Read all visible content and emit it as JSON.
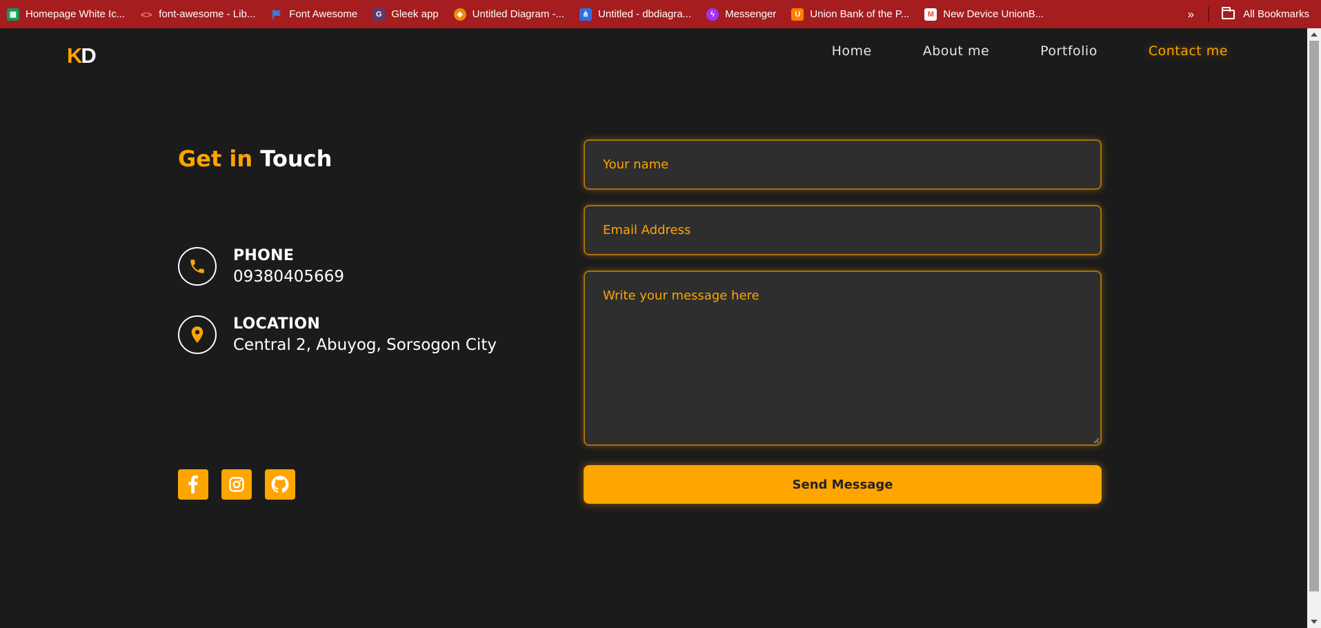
{
  "bookmarks": {
    "items": [
      {
        "label": "Homepage White Ic...",
        "icon": "sheets-icon",
        "color": "#0f9d58"
      },
      {
        "label": "font-awesome - Lib...",
        "icon": "code-icon",
        "color": "#e8453c"
      },
      {
        "label": "Font Awesome",
        "icon": "flag-icon",
        "color": "#3a7bd5"
      },
      {
        "label": "Gleek app",
        "icon": "gleek-icon",
        "color": "#5b3a6e"
      },
      {
        "label": "Untitled Diagram -...",
        "icon": "drawio-icon",
        "color": "#f08705"
      },
      {
        "label": "Untitled - dbdiagra...",
        "icon": "share-icon",
        "color": "#2f6fe4"
      },
      {
        "label": "Messenger",
        "icon": "messenger-icon",
        "color": "#a033ff"
      },
      {
        "label": "Union Bank of the P...",
        "icon": "unionbank-icon",
        "color": "#ff8000"
      },
      {
        "label": "New Device UnionB...",
        "icon": "gmail-icon",
        "color": "#ea4335"
      }
    ],
    "overflow": "»",
    "all_bookmarks": "All Bookmarks"
  },
  "header": {
    "logo_k": "K",
    "logo_d": "D",
    "nav": [
      "Home",
      "About me",
      "Portfolio",
      "Contact me"
    ],
    "active": "Contact me"
  },
  "contact": {
    "title_accent": "Get in",
    "title_rest": "Touch",
    "phone_label": "PHONE",
    "phone_value": "09380405669",
    "location_label": "LOCATION",
    "location_value": "Central 2, Abuyog, Sorsogon City",
    "socials": [
      "facebook-icon",
      "instagram-icon",
      "github-icon"
    ]
  },
  "form": {
    "name_placeholder": "Your name",
    "email_placeholder": "Email Address",
    "message_placeholder": "Write your message here",
    "send_label": "Send Message"
  },
  "colors": {
    "accent": "#ffa500",
    "background": "#1b1b1b",
    "field_bg": "#2e2e2e",
    "bookmarks_bar": "#a51d1e"
  }
}
